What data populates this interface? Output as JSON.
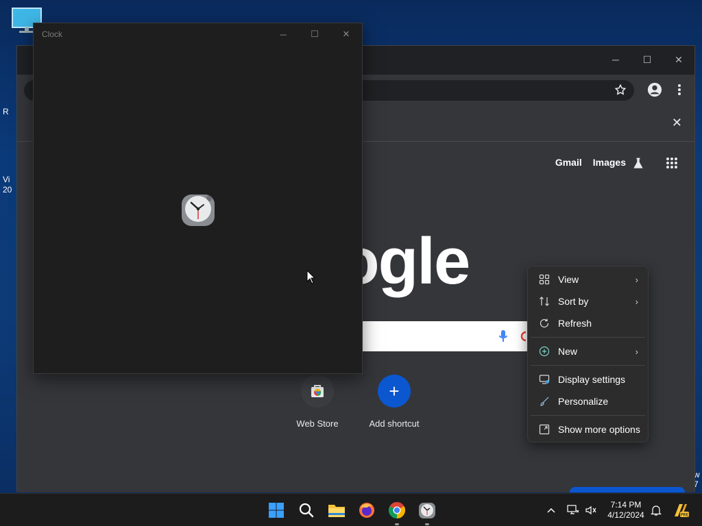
{
  "desktop": {
    "icon_name": "monitor-icon",
    "partial_labels": [
      "R",
      "Vi",
      "20",
      "w",
      "7"
    ]
  },
  "clock_window": {
    "title": "Clock",
    "minimize": "─",
    "maximize": "☐",
    "close": "✕"
  },
  "chrome": {
    "min": "─",
    "max": "☐",
    "close": "✕",
    "infobar_close": "✕",
    "top_links": {
      "gmail": "Gmail",
      "images": "Images"
    },
    "logo_partial": "ogle",
    "shortcuts": [
      {
        "label": "Web Store"
      },
      {
        "label": "Add shortcut",
        "symbol": "+"
      }
    ],
    "accent": "#1a73e8"
  },
  "context_menu": {
    "items": [
      {
        "label": "View",
        "icon": "grid-icon",
        "has_submenu": true
      },
      {
        "label": "Sort by",
        "icon": "sort-icon",
        "has_submenu": true
      },
      {
        "label": "Refresh",
        "icon": "refresh-icon",
        "has_submenu": false
      },
      {
        "label": "New",
        "icon": "plus-circle-icon",
        "has_submenu": true
      },
      {
        "label": "Display settings",
        "icon": "display-icon",
        "has_submenu": false
      },
      {
        "label": "Personalize",
        "icon": "brush-icon",
        "has_submenu": false
      },
      {
        "label": "Show more options",
        "icon": "expand-icon",
        "has_submenu": false
      }
    ],
    "chevron": "›"
  },
  "taskbar": {
    "apps": [
      "windows-start-icon",
      "search-icon",
      "file-explorer-icon",
      "firefox-icon",
      "chrome-icon",
      "clock-icon"
    ],
    "tray": {
      "time": "7:14 PM",
      "date": "4/12/2024",
      "chevron_up": "^"
    }
  }
}
